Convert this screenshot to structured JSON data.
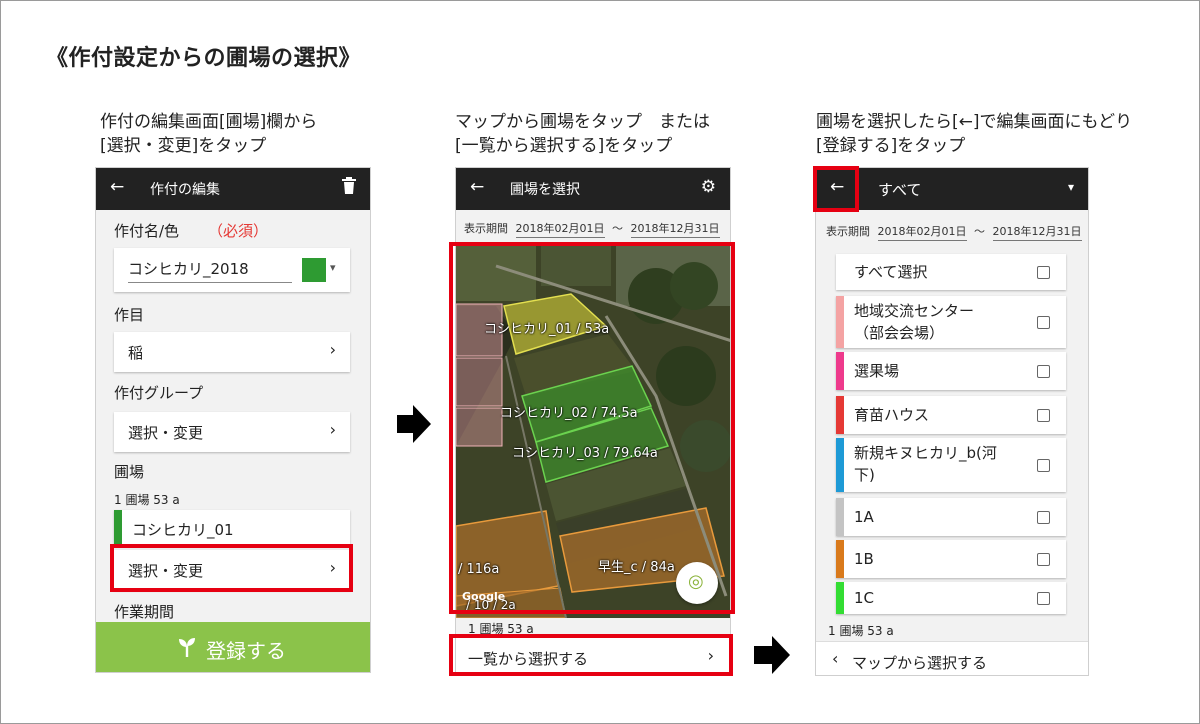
{
  "page_title": "《作付設定からの圃場の選択》",
  "captions": {
    "step1_line1": "作付の編集画面[圃場]欄から",
    "step1_line2": "[選択・変更]をタップ",
    "step2_line1": "マップから圃場をタップ　または",
    "step2_line2": "[一覧から選択する]をタップ",
    "step3_line1": "圃場を選択したら[←]で編集画面にもどり",
    "step3_line2": "[登録する]をタップ"
  },
  "screen1": {
    "back_icon": "←",
    "title": "作付の編集",
    "delete_icon": "trash-icon",
    "name_label": "作付名/色",
    "required_label": "（必須）",
    "name_value": "コシヒカリ_2018",
    "color": "#2e9b32",
    "color_caret": "▾",
    "crop_label": "作目",
    "crop_value": "稲",
    "group_label": "作付グループ",
    "group_value": "選択・変更",
    "field_label": "圃場",
    "field_count": "1 圃場 53 a",
    "field_item": "コシヒカリ_01",
    "field_item_color": "#2e9b32",
    "select_change": "選択・変更",
    "period_label": "作業期間",
    "register_button": "登録する",
    "register_color": "#8bc34a",
    "chevron": "›"
  },
  "screen2": {
    "back_icon": "←",
    "title": "圃場を選択",
    "settings_icon": "⚙",
    "period_label": "表示期間",
    "date_from": "2018年02月01日",
    "tilde": "〜",
    "date_to": "2018年12月31日",
    "map_fields": [
      "コシヒカリ_01 / 53a",
      "コシヒカリ_02 / 74.5a",
      "コシヒカリ_03 / 79.64a",
      "/ 116a",
      "早生_c / 84a",
      "/ 10 / 2a"
    ],
    "google_logo": "Google",
    "locate_icon": "◎",
    "field_count": "1 圃場 53 a",
    "list_select": "一覧から選択する",
    "chevron": "›"
  },
  "screen3": {
    "back_icon": "←",
    "title": "すべて",
    "dropdown_icon": "▾",
    "period_label": "表示期間",
    "date_from": "2018年02月01日",
    "tilde": "〜",
    "date_to": "2018年12月31日",
    "items": [
      {
        "label": "すべて選択",
        "color": "#ffffff"
      },
      {
        "label": "地域交流センター\n（部会会場）",
        "color": "#f4a3a3"
      },
      {
        "label": "選果場",
        "color": "#ee3a8c"
      },
      {
        "label": "育苗ハウス",
        "color": "#e53935"
      },
      {
        "label": "新規キヌヒカリ_b(河\n下)",
        "color": "#1e9ad6"
      },
      {
        "label": "1A",
        "color": "#c4c4c4"
      },
      {
        "label": "1B",
        "color": "#d97a1c"
      },
      {
        "label": "1C",
        "color": "#33dd33"
      }
    ],
    "field_count": "1 圃場 53 a",
    "map_select_chevron": "‹",
    "map_select": "マップから選択する"
  }
}
